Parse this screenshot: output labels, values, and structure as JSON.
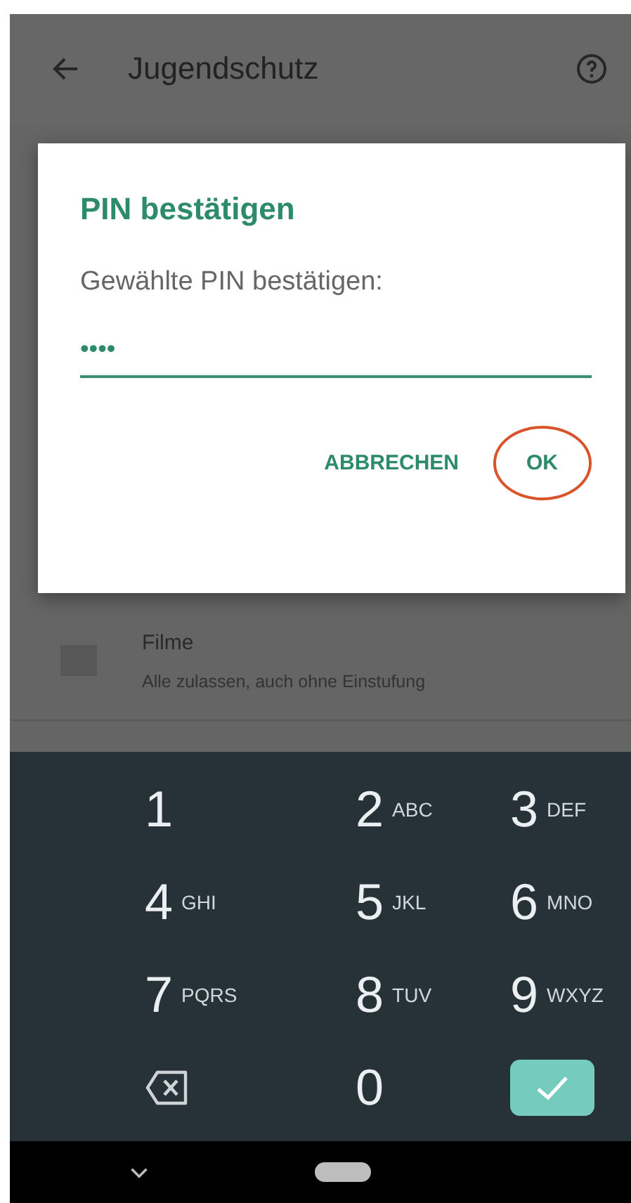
{
  "app_bar": {
    "title": "Jugendschutz"
  },
  "dialog": {
    "title": "PIN bestätigen",
    "message": "Gewählte PIN bestätigen:",
    "field": {
      "value": "••••"
    },
    "buttons": [
      {
        "label": "ABBRECHEN",
        "highlighted": false
      },
      {
        "label": "OK",
        "highlighted": true
      }
    ]
  },
  "list": [
    {
      "title": "Filme",
      "subtitle": "Alle zulassen, auch ohne Einstufung"
    }
  ],
  "keypad": [
    {
      "kind": "digit",
      "digit": "1"
    },
    {
      "kind": "digit",
      "digit": "2",
      "letters": "ABC"
    },
    {
      "kind": "digit",
      "digit": "3",
      "letters": "DEF"
    },
    {
      "kind": "digit",
      "digit": "4",
      "letters": "GHI"
    },
    {
      "kind": "digit",
      "digit": "5",
      "letters": "JKL"
    },
    {
      "kind": "digit",
      "digit": "6",
      "letters": "MNO"
    },
    {
      "kind": "digit",
      "digit": "7",
      "letters": "PQRS"
    },
    {
      "kind": "digit",
      "digit": "8",
      "letters": "TUV"
    },
    {
      "kind": "digit",
      "digit": "9",
      "letters": "WXYZ"
    },
    {
      "kind": "backspace"
    },
    {
      "kind": "digit",
      "digit": "0"
    },
    {
      "kind": "enter"
    }
  ]
}
